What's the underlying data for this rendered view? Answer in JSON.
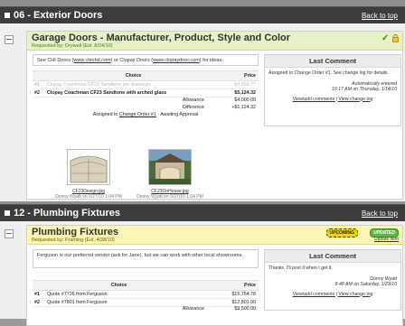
{
  "sections": [
    {
      "title": "06 - Exterior Doors",
      "back_to_top": "Back to top",
      "item": {
        "title": "Garage Doors - Manufacturer, Product, Style and Color",
        "requested_prefix": "Requested by: ",
        "requested_by": "Drywall",
        "requested_est": " (Est. 8/24/10)",
        "note_parts": {
          "a": "See CHI Doors (",
          "link1": "www.chiohd.com",
          "b": ") or Clopay Doors (",
          "link2": "www.clopaydoor.com",
          "c": ") for ideas."
        },
        "table_headers": {
          "choice": "Choice",
          "price": "Price"
        },
        "rows": [
          {
            "num": "#1",
            "choice": "Clopay Coachman CF23 Sandtone per drawings",
            "price": "$4,669.77"
          },
          {
            "num": "#2",
            "choice": "Clopay Coachman CF23 Sandtone with arched glass",
            "price": "$5,124.32"
          }
        ],
        "allowance_label": "Allowance",
        "allowance_value": "$4,000.00",
        "difference_label": "Difference",
        "difference_value": "+$1,124.32",
        "assigned_prefix": "Assigned to ",
        "assigned_link": "Change Order #1",
        "assigned_suffix": " - Awaiting Approval",
        "attachments": [
          {
            "filename": "CF23Design.jpg",
            "meta": "Donny Wyatt on 5/27/10 1:04 PM"
          },
          {
            "filename": "CF23OnHouse.jpg",
            "meta": "Donny Wyatt on 5/27/10 1:04 PM"
          }
        ],
        "comment": {
          "header": "Last Comment",
          "text": "Assigned to Change Order #1. See change log for details.",
          "meta_line1": "Automatically entered",
          "meta_line2": "10:17 AM on Thursday, 1/14/10",
          "links": "View/add comments | View change log"
        }
      }
    },
    {
      "title": "12 - Plumbing Fixtures",
      "back_to_top": "Back to top",
      "item": {
        "title": "Plumbing Fixtures",
        "requested_prefix": "Requested by: ",
        "requested_by": "Framing",
        "requested_est": " (Est. 4/28/10)",
        "badge_upcoming": "UPCOMING",
        "badge_updated": "UPDATED",
        "update_item": "Update item",
        "note": "Ferguson is our preferred vendor (ask for Jane), but we can work with other local showrooms.",
        "table_headers": {
          "choice": "Choice",
          "price": "Price"
        },
        "rows": [
          {
            "num": "#1",
            "choice": "Quote #7726 from Ferguson",
            "price": "$15,754.78"
          },
          {
            "num": "#2",
            "choice": "Quote #7801 from Ferguson",
            "price": "$12,801.00"
          }
        ],
        "allowance_label": "Allowance",
        "allowance_value": "$9,500.00",
        "comment": {
          "header": "Last Comment",
          "text": "Thanks. I'll post it when I get it.",
          "meta_line1": "Donny Wyatt",
          "meta_line2": "8:48 AM on Saturday, 1/23/10",
          "links": "View/add comments | View change log"
        }
      }
    }
  ],
  "colors": {
    "green_header": "#e5f2c6",
    "yellow_header": "#fbf6b5",
    "section_bar": "#3c3c3c"
  }
}
